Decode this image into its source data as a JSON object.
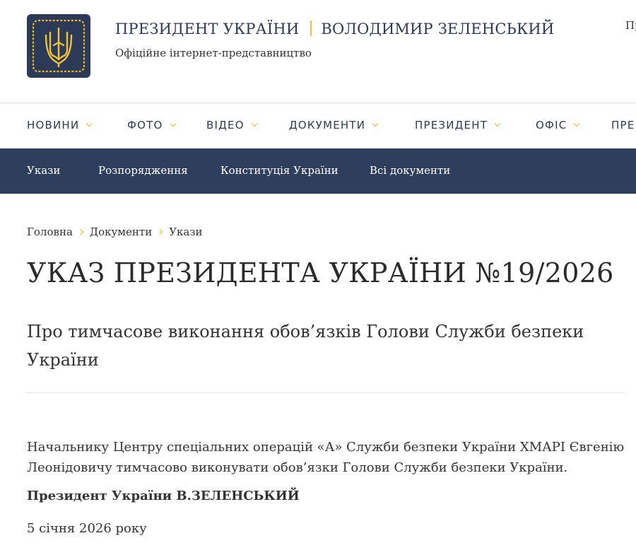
{
  "header": {
    "title_left": "ПРЕЗИДЕНТ УКРАЇНИ",
    "title_right": "ВОЛОДИМИР ЗЕЛЕНСЬКИЙ",
    "subtitle": "Офіційне інтернет-представництво",
    "lang_partial": "Пр",
    "logo_icon": "trident-emblem-icon"
  },
  "main_nav": {
    "items": [
      {
        "label": "НОВИНИ",
        "has_dropdown": true
      },
      {
        "label": "ФОТО",
        "has_dropdown": true
      },
      {
        "label": "ВІДЕО",
        "has_dropdown": true
      },
      {
        "label": "ДОКУМЕНТИ",
        "has_dropdown": true
      },
      {
        "label": "ПРЕЗИДЕНТ",
        "has_dropdown": true
      },
      {
        "label": "ОФІС",
        "has_dropdown": true
      },
      {
        "label": "ПРЕ",
        "has_dropdown": false
      }
    ]
  },
  "sub_nav": {
    "items": [
      {
        "label": "Укази"
      },
      {
        "label": "Розпорядження"
      },
      {
        "label": "Конституція України"
      },
      {
        "label": "Всі документи"
      }
    ]
  },
  "breadcrumb": [
    "Головна",
    "Документи",
    "Укази"
  ],
  "document": {
    "title": "УКАЗ ПРЕЗИДЕНТА УКРАЇНИ №19/2026",
    "subtitle": "Про тимчасове виконання обов’язків Голови Служби безпеки України",
    "body": "Начальнику Центру спеціальних операцій «А» Служби безпеки України ХМАРІ Євгенію Леонідовичу тимчасово виконувати обов’язки Голови Служби безпеки України.",
    "signature": "Президент України В.ЗЕЛЕНСЬКИЙ",
    "date": "5 січня 2026 року"
  },
  "colors": {
    "brand_navy": "#2f3e5c",
    "accent_gold": "#f2c335"
  }
}
